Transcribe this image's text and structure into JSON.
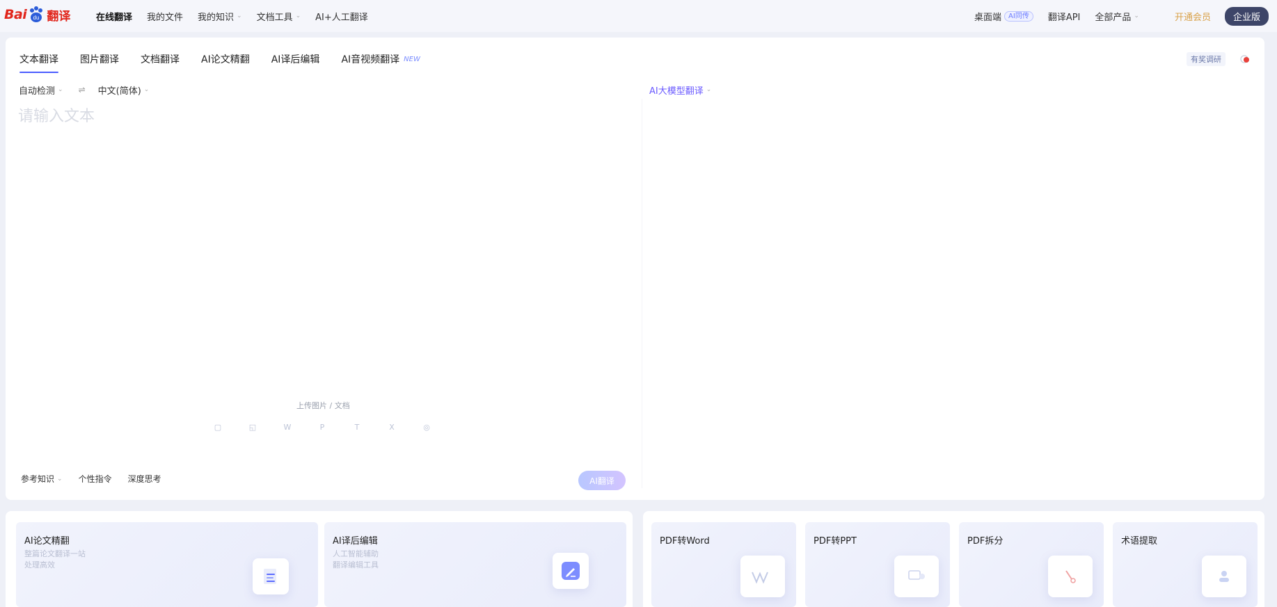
{
  "header": {
    "logo_text_1": "Bai",
    "logo_text_2": "翻译",
    "nav": [
      {
        "label": "在线翻译"
      },
      {
        "label": "我的文件"
      },
      {
        "label": "我的知识"
      },
      {
        "label": "文档工具"
      },
      {
        "label": "AI+人工翻译"
      }
    ],
    "desktop_label": "桌面端",
    "desktop_tag": "AI同传",
    "api_label": "翻译API",
    "products_label": "全部产品",
    "vip_label": "开通会员",
    "enterprise_label": "企业版"
  },
  "tabs": [
    {
      "label": "文本翻译"
    },
    {
      "label": "图片翻译"
    },
    {
      "label": "文档翻译"
    },
    {
      "label": "AI论文精翻"
    },
    {
      "label": "AI译后编辑"
    },
    {
      "label": "AI音视频翻译"
    }
  ],
  "new_tag": "NEW",
  "feedback_label": "有奖调研",
  "source_lang": "自动检测",
  "swap_symbol": "⇌",
  "target_lang": "中文(简体)",
  "model_select": "AI大模型翻译",
  "source_placeholder": "请输入文本",
  "upload_hint": "上传图片 / 文档",
  "file_types": [
    {
      "label": "▢"
    },
    {
      "label": "◱"
    },
    {
      "label": "W"
    },
    {
      "label": "P"
    },
    {
      "label": "T"
    },
    {
      "label": "X"
    },
    {
      "label": "◎"
    }
  ],
  "bottom_options": [
    {
      "label": "参考知识"
    },
    {
      "label": "个性指令"
    },
    {
      "label": "深度思考"
    }
  ],
  "translate_button": "AI翻译",
  "cards_left": [
    {
      "title": "AI论文精翻",
      "sub1": "整篇论文翻译一站",
      "sub2": "处理高效"
    },
    {
      "title": "AI译后编辑",
      "sub1": "人工智能辅助",
      "sub2": "翻译编辑工具"
    }
  ],
  "cards_right": [
    {
      "title": "PDF转Word"
    },
    {
      "title": "PDF转PPT"
    },
    {
      "title": "PDF拆分"
    },
    {
      "title": "术语提取"
    }
  ],
  "colors": {
    "accent": "#4a5cff",
    "brand_red": "#e1251b",
    "model_purple": "#6b5bff"
  }
}
